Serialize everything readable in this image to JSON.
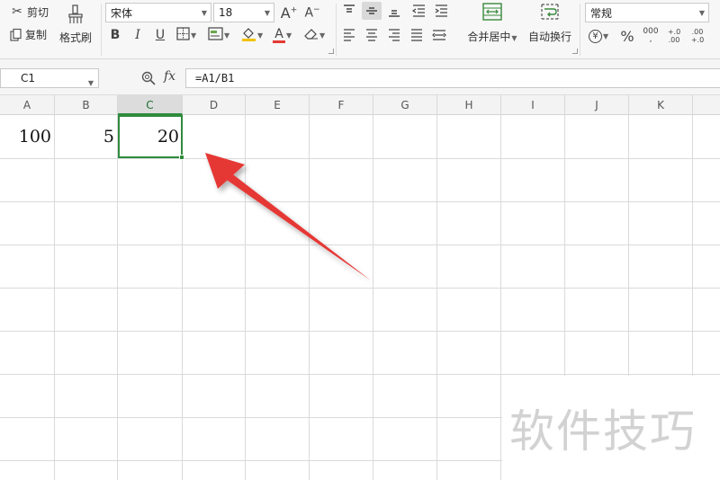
{
  "ribbon": {
    "clipboard": {
      "cut_label": "剪切",
      "copy_label": "复制",
      "format_painter_label": "格式刷"
    },
    "font": {
      "name": "宋体",
      "size": "18",
      "bold": "B",
      "italic": "I",
      "underline": "U",
      "color_glyph": "A"
    },
    "alignment": {
      "merge_label": "合并居中",
      "wrap_label": "自动换行"
    },
    "number": {
      "format": "常规",
      "currency": "¥",
      "percent": "%",
      "thousands": "000",
      "inc_decimal": "+.0\n.00",
      "dec_decimal": ".00\n+.0"
    }
  },
  "formula_bar": {
    "name_box": "C1",
    "fx_label": "fx",
    "formula": "=A1/B1"
  },
  "sheet": {
    "columns": [
      "A",
      "B",
      "C",
      "D",
      "E",
      "F",
      "G",
      "H",
      "I",
      "J",
      "K"
    ],
    "selected_column": "C",
    "selected_cell": "C1",
    "cells": {
      "A1": "100",
      "B1": "5",
      "C1": "20"
    }
  },
  "colors": {
    "selection": "#2e8b3d",
    "arrow": "#e53935",
    "font_color_bar": "#e53935"
  },
  "watermark": "软件技巧"
}
